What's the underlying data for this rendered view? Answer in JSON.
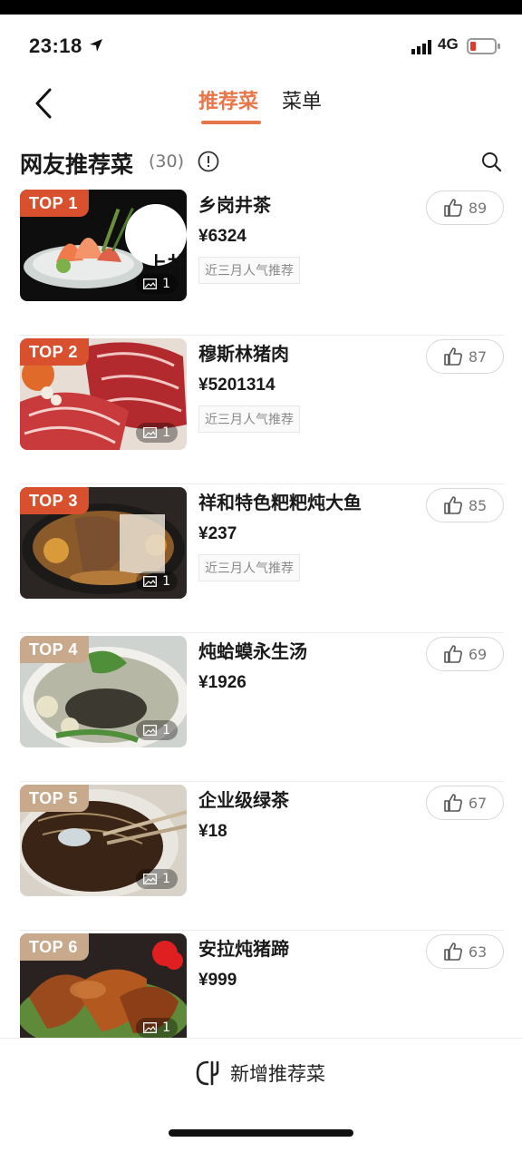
{
  "status": {
    "time": "23:18",
    "network": "4G",
    "accent": "#e8764a"
  },
  "nav": {
    "tabs": [
      {
        "label": "推荐菜",
        "active": true
      },
      {
        "label": "菜单",
        "active": false
      }
    ]
  },
  "section": {
    "title": "网友推荐菜",
    "count": "(30)"
  },
  "dishes": [
    {
      "rank": "TOP 1",
      "name": "乡岗井茶",
      "price": "¥6324",
      "tag": "近三月人气推荐",
      "likes": "89",
      "photos": "1",
      "image": "sashimi platter"
    },
    {
      "rank": "TOP 2",
      "name": "穆斯林猪肉",
      "price": "¥5201314",
      "tag": "近三月人气推荐",
      "likes": "87",
      "photos": "1",
      "image": "marbled raw meat"
    },
    {
      "rank": "TOP 3",
      "name": "祥和特色粑粑炖大鱼",
      "price": "¥237",
      "tag": "近三月人气推荐",
      "likes": "85",
      "photos": "1",
      "image": "braised fish in pot"
    },
    {
      "rank": "TOP 4",
      "name": "炖蛤蟆永生汤",
      "price": "¥1926",
      "tag": "",
      "likes": "69",
      "photos": "1",
      "image": "frog soup bowl"
    },
    {
      "rank": "TOP 5",
      "name": "企业级绿茶",
      "price": "¥18",
      "tag": "",
      "likes": "67",
      "photos": "1",
      "image": "dark soup with chopsticks"
    },
    {
      "rank": "TOP 6",
      "name": "安拉炖猪蹄",
      "price": "¥999",
      "tag": "",
      "likes": "63",
      "photos": "1",
      "image": "braised pork trotters"
    }
  ],
  "footer": {
    "add_label": "新增推荐菜"
  },
  "colors": {
    "badge_hot": "#d9502e",
    "badge_warm": "#c9a98c"
  }
}
